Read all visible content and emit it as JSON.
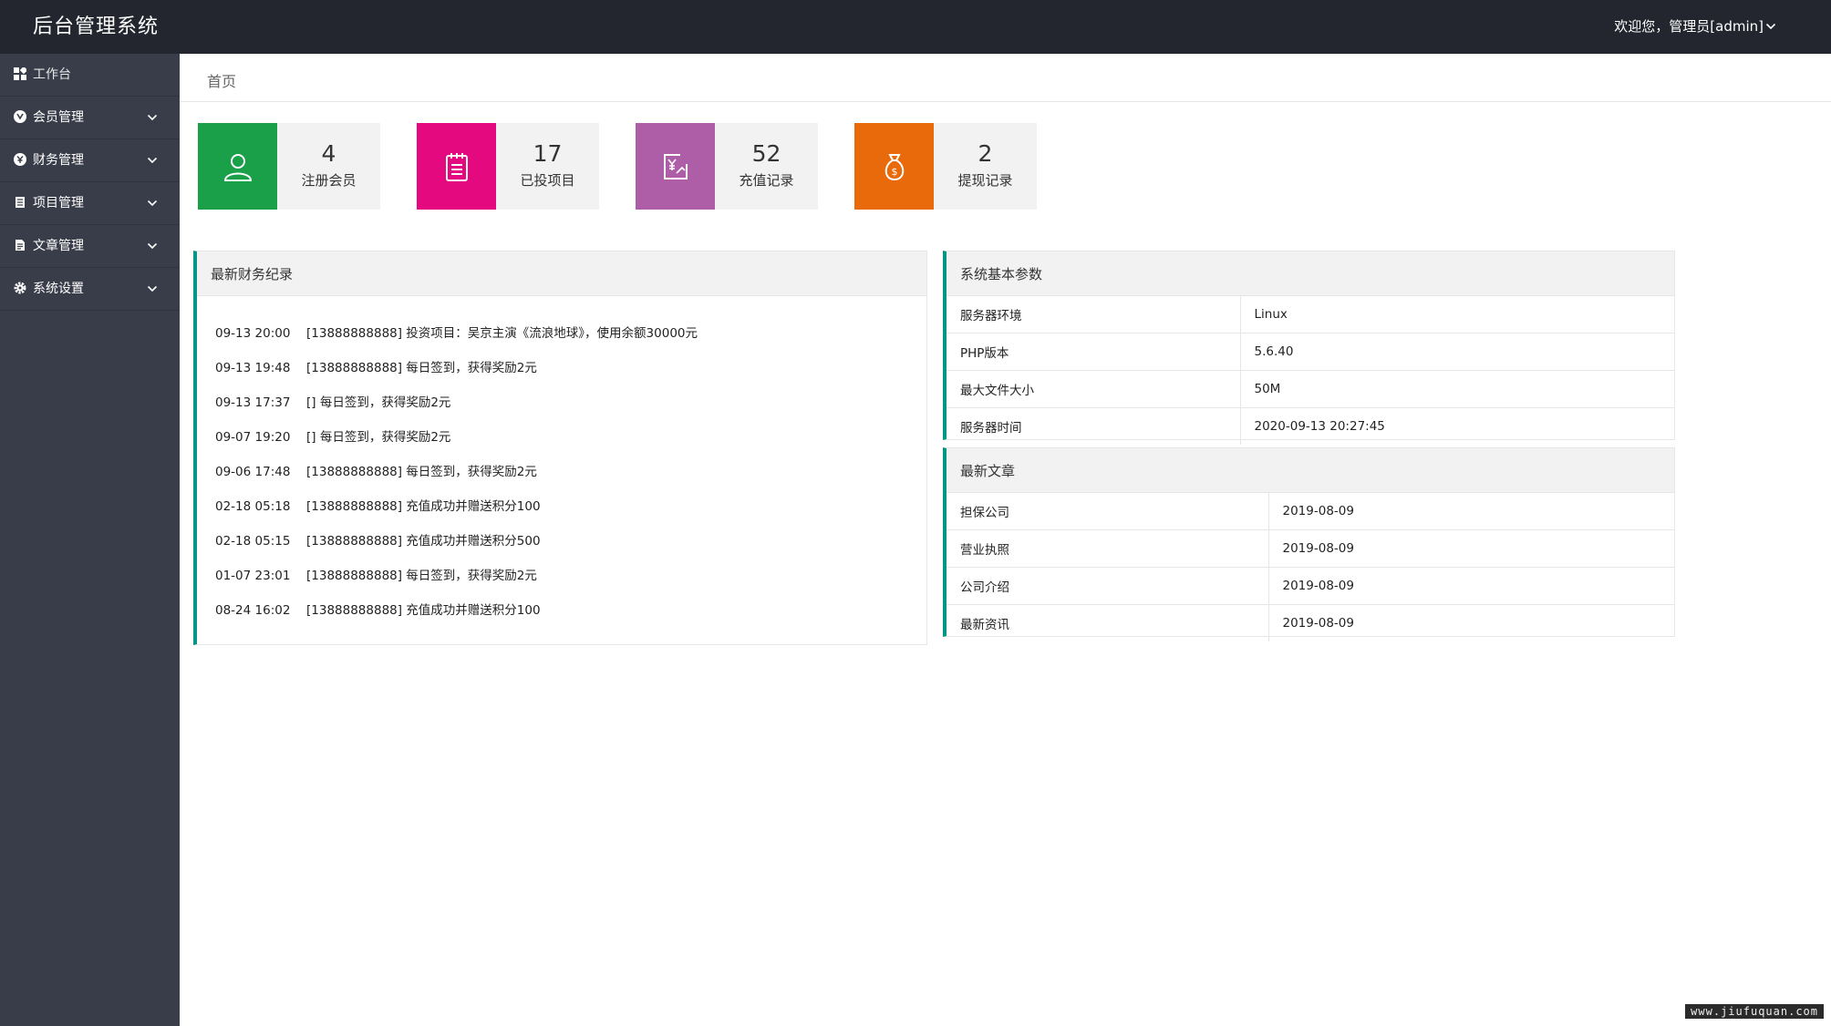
{
  "header": {
    "title": "后台管理系统",
    "user_text": "欢迎您，管理员[admin]"
  },
  "sidebar": {
    "items": [
      {
        "label": "工作台",
        "icon": "dashboard-icon"
      },
      {
        "label": "会员管理",
        "icon": "member-icon"
      },
      {
        "label": "财务管理",
        "icon": "finance-icon"
      },
      {
        "label": "项目管理",
        "icon": "project-icon"
      },
      {
        "label": "文章管理",
        "icon": "article-icon"
      },
      {
        "label": "系统设置",
        "icon": "settings-icon"
      }
    ]
  },
  "breadcrumb": "首页",
  "stats": [
    {
      "value": "4",
      "label": "注册会员",
      "color": "#1aa049",
      "icon": "user-icon"
    },
    {
      "value": "17",
      "label": "已投项目",
      "color": "#e4097f",
      "icon": "clipboard-icon"
    },
    {
      "value": "52",
      "label": "充值记录",
      "color": "#ad5ea7",
      "icon": "recharge-icon"
    },
    {
      "value": "2",
      "label": "提现记录",
      "color": "#e96a0b",
      "icon": "money-bag-icon"
    }
  ],
  "finance": {
    "title": "最新财务纪录",
    "records": [
      {
        "time": "09-13 20:00",
        "text": "[13888888888] 投资项目：吴京主演《流浪地球》，使用余额30000元"
      },
      {
        "time": "09-13 19:48",
        "text": "[13888888888] 每日签到，获得奖励2元"
      },
      {
        "time": "09-13 17:37",
        "text": "[] 每日签到，获得奖励2元"
      },
      {
        "time": "09-07 19:20",
        "text": "[] 每日签到，获得奖励2元"
      },
      {
        "time": "09-06 17:48",
        "text": "[13888888888] 每日签到，获得奖励2元"
      },
      {
        "time": "02-18 05:18",
        "text": "[13888888888] 充值成功并赠送积分100"
      },
      {
        "time": "02-18 05:15",
        "text": "[13888888888] 充值成功并赠送积分500"
      },
      {
        "time": "01-07 23:01",
        "text": "[13888888888] 每日签到，获得奖励2元"
      },
      {
        "time": "08-24 16:02",
        "text": "[13888888888] 充值成功并赠送积分100"
      }
    ]
  },
  "system": {
    "title": "系统基本参数",
    "rows": [
      {
        "key": "服务器环境",
        "value": "Linux"
      },
      {
        "key": "PHP版本",
        "value": "5.6.40"
      },
      {
        "key": "最大文件大小",
        "value": "50M"
      },
      {
        "key": "服务器时间",
        "value": "2020-09-13 20:27:45"
      }
    ]
  },
  "articles": {
    "title": "最新文章",
    "rows": [
      {
        "key": "担保公司",
        "value": "2019-08-09"
      },
      {
        "key": "营业执照",
        "value": "2019-08-09"
      },
      {
        "key": "公司介绍",
        "value": "2019-08-09"
      },
      {
        "key": "最新资讯",
        "value": "2019-08-09"
      }
    ]
  },
  "watermark": "www.jiufuquan.com"
}
